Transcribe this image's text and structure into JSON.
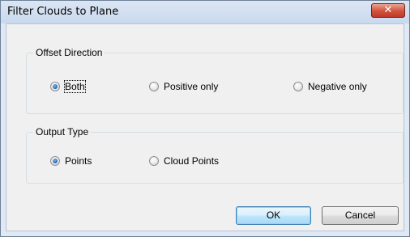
{
  "dialog": {
    "title": "Filter Clouds to Plane",
    "close_icon": "close-icon",
    "close_glyph": "✕"
  },
  "offset_direction": {
    "legend": "Offset Direction",
    "options": [
      {
        "label": "Both",
        "selected": true
      },
      {
        "label": "Positive only",
        "selected": false
      },
      {
        "label": "Negative only",
        "selected": false
      }
    ]
  },
  "output_type": {
    "legend": "Output Type",
    "options": [
      {
        "label": "Points",
        "selected": true
      },
      {
        "label": "Cloud Points",
        "selected": false
      }
    ]
  },
  "buttons": {
    "ok_label": "OK",
    "cancel_label": "Cancel"
  },
  "colors": {
    "close_button": "#c0392b",
    "selected_radio": "#1e63b5"
  }
}
